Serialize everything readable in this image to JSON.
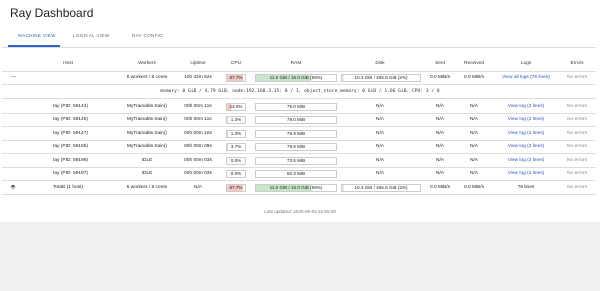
{
  "app": {
    "title": "Ray Dashboard"
  },
  "tabs": [
    {
      "label": "MACHINE VIEW"
    },
    {
      "label": "LOGICAL VIEW"
    },
    {
      "label": "RAY CONFIG"
    }
  ],
  "active_tab": 0,
  "headers": {
    "host": "Host",
    "workers": "Workers",
    "uptime": "Uptime",
    "cpu": "CPU",
    "ram": "RAM",
    "disk": "Disk",
    "sent": "Sent",
    "received": "Received",
    "logs": "Logs",
    "errors": "Errors"
  },
  "node": {
    "collapse_symbol": "—",
    "workers": "6 workers / 8 cores",
    "uptime": "10h 42m 52s",
    "cpu": "87.7%",
    "cpu_fraction": 0.877,
    "ram": "11.0 GiB / 16.0 GiB (69%)",
    "ram_fraction": 0.69,
    "disk": "10.4 GiB / 465.6 GiB (2%)",
    "disk_fraction": 0.02,
    "sent": "0.0 MiB/s",
    "received": "0.0 MiB/s",
    "logs": "View all logs (76 lines)",
    "errors": "No errors"
  },
  "memory_line": "memory: 0 GiB / 4.79 GiB, node:192.168.3.15: 0 / 1, object_store_memory: 0 GiB / 1.66 GiB, CPU: 3 / 8",
  "workers": [
    {
      "host": "ray (PID: 59144)",
      "workers": "MyTrainable.train()",
      "uptime": "00h 00m 11s",
      "cpu": "23.0%",
      "cpu_fraction": 0.23,
      "ram": "79.0 MiB",
      "disk": "N/A",
      "sent": "N/A",
      "received": "N/A",
      "logs": "View log (2 lines)",
      "errors": "No errors"
    },
    {
      "host": "ray (PID: 59145)",
      "workers": "MyTrainable.train()",
      "uptime": "00h 00m 11s",
      "cpu": "1.3%",
      "cpu_fraction": 0.013,
      "ram": "79.0 MiB",
      "disk": "N/A",
      "sent": "N/A",
      "received": "N/A",
      "logs": "View log (2 lines)",
      "errors": "No errors"
    },
    {
      "host": "ray (PID: 59147)",
      "workers": "MyTrainable.train()",
      "uptime": "00h 00m 10s",
      "cpu": "1.3%",
      "cpu_fraction": 0.013,
      "ram": "78.9 MiB",
      "disk": "N/A",
      "sent": "N/A",
      "received": "N/A",
      "logs": "View log (2 lines)",
      "errors": "No errors"
    },
    {
      "host": "ray (PID: 59155)",
      "workers": "MyTrainable.train()",
      "uptime": "00h 00m 09s",
      "cpu": "3.7%",
      "cpu_fraction": 0.037,
      "ram": "78.9 MiB",
      "disk": "N/A",
      "sent": "N/A",
      "received": "N/A",
      "logs": "View log (2 lines)",
      "errors": "No errors"
    },
    {
      "host": "ray (PID: 59196)",
      "workers": "IDLE",
      "uptime": "00h 00m 03s",
      "cpu": "0.0%",
      "cpu_fraction": 0.0,
      "ram": "73.5 MiB",
      "disk": "N/A",
      "sent": "N/A",
      "received": "N/A",
      "logs": "View log (2 lines)",
      "errors": "No errors"
    },
    {
      "host": "ray (PID: 59197)",
      "workers": "IDLE",
      "uptime": "00h 00m 03s",
      "cpu": "0.0%",
      "cpu_fraction": 0.0,
      "ram": "50.3 MiB",
      "disk": "N/A",
      "sent": "N/A",
      "received": "N/A",
      "logs": "View log (2 lines)",
      "errors": "No errors"
    }
  ],
  "totals": {
    "expand_icon": "layers-icon",
    "host": "Totals (1 host)",
    "workers": "6 workers / 8 cores",
    "uptime": "N/A",
    "cpu": "87.7%",
    "cpu_fraction": 0.877,
    "ram": "11.0 GiB / 16.0 GiB (69%)",
    "ram_fraction": 0.69,
    "disk": "10.4 GiB / 465.6 GiB (2%)",
    "disk_fraction": 0.02,
    "sent": "0.0 MiB/s",
    "received": "0.0 MiB/s",
    "logs": "76 lines",
    "errors": "No errors"
  },
  "footer": "Last updated: 2020-06-03 22:55:08",
  "colors": {
    "accent": "#2a63c9",
    "cpu_fill": "#f4c7c3",
    "ram_fill": "#c8e6c9",
    "disk_fill": "#dbe8f6"
  }
}
